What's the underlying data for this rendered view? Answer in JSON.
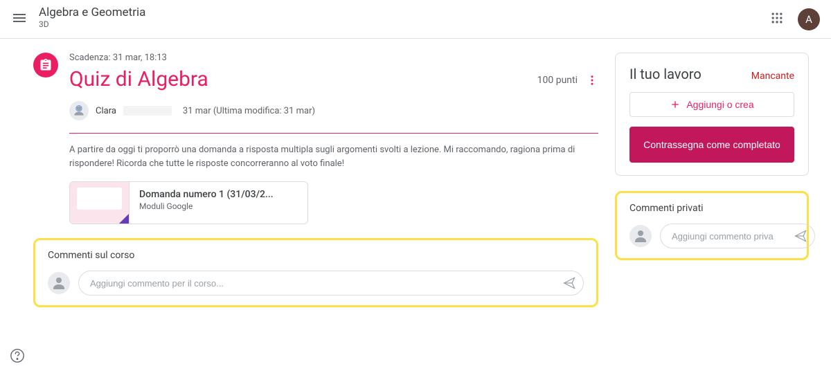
{
  "header": {
    "course_title": "Algebra e Geometria",
    "course_section": "3D",
    "avatar_initial": "A"
  },
  "assignment": {
    "due_date": "Scadenza: 31 mar, 18:13",
    "title": "Quiz di Algebra",
    "points": "100 punti",
    "teacher_name": "Clara",
    "posted_date": "31 mar (Ultima modifica: 31 mar)",
    "description": "A partire da oggi ti proporrò una domanda a risposta multipla sugli argomenti svolti a lezione. Mi raccomando, ragiona prima di rispondere! Ricorda che tutte le risposte concorreranno al voto finale!",
    "attachment": {
      "title": "Domanda numero 1 (31/03/2...",
      "type": "Moduli Google"
    }
  },
  "course_comments": {
    "label": "Commenti sul corso",
    "placeholder": "Aggiungi commento per il corso..."
  },
  "work_panel": {
    "title": "Il tuo lavoro",
    "status": "Mancante",
    "add_label": "Aggiungi o crea",
    "mark_label": "Contrassegna come completato"
  },
  "private_comments": {
    "label": "Commenti privati",
    "placeholder": "Aggiungi commento priva"
  }
}
